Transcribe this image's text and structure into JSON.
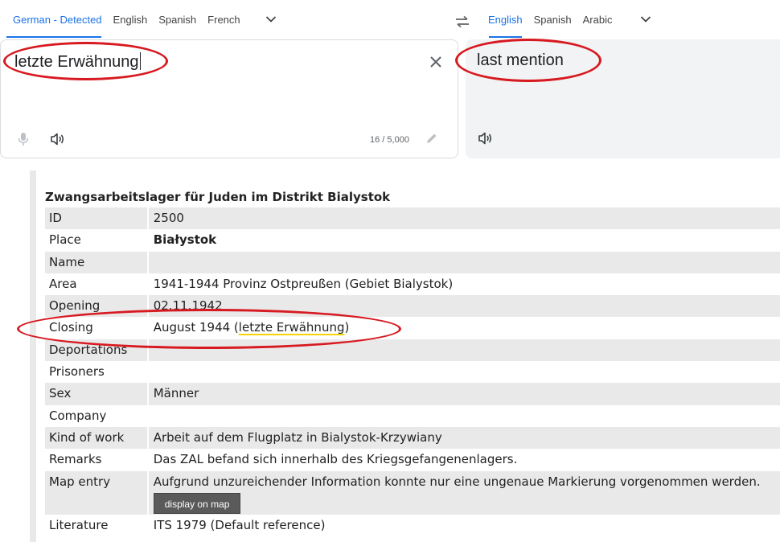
{
  "source_languages": {
    "tabs": [
      "German - Detected",
      "English",
      "Spanish",
      "French"
    ],
    "active": 0
  },
  "target_languages": {
    "tabs": [
      "English",
      "Spanish",
      "Arabic"
    ],
    "active": 0
  },
  "source_panel": {
    "text": "letzte Erwähnung",
    "char_count": "16 / 5,000"
  },
  "target_panel": {
    "text": "last mention"
  },
  "record": {
    "title": "Zwangsarbeitslager für Juden im Distrikt Bialystok",
    "rows": [
      {
        "label": "ID",
        "value": "2500"
      },
      {
        "label": "Place",
        "value": "Białystok"
      },
      {
        "label": "Name",
        "value": ""
      },
      {
        "label": "Area",
        "value": "1941-1944 Provinz Ostpreußen (Gebiet Bialystok)"
      },
      {
        "label": "Opening",
        "value": "02.11.1942"
      },
      {
        "label": "Closing",
        "value_prefix": "August 1944 (",
        "value_highlight": "letzte Erwähnung",
        "value_suffix": ")"
      },
      {
        "label": "Deportations",
        "value": ""
      },
      {
        "label": "Prisoners",
        "value": ""
      },
      {
        "label": "Sex",
        "value": "Männer"
      },
      {
        "label": "Company",
        "value": ""
      },
      {
        "label": "Kind of work",
        "value": "Arbeit auf dem Flugplatz in Bialystok-Krzywiany"
      },
      {
        "label": "Remarks",
        "value": "Das ZAL befand sich innerhalb des Kriegsgefangenenlagers."
      },
      {
        "label": "Map entry",
        "value": "Aufgrund unzureichender Information konnte nur eine ungenaue Markierung vorgenommen werden.",
        "button": "display on map"
      },
      {
        "label": "Literature",
        "value": "ITS 1979 (Default reference)"
      }
    ]
  },
  "colors": {
    "accent": "#1a73e8",
    "annotation": "#d71920",
    "highlight_underline": "#f5d400",
    "row_shade": "#e9e9e9"
  },
  "icons": [
    "chevron-down-icon",
    "swap-icon",
    "close-icon",
    "microphone-icon",
    "speaker-icon",
    "pencil-icon"
  ]
}
